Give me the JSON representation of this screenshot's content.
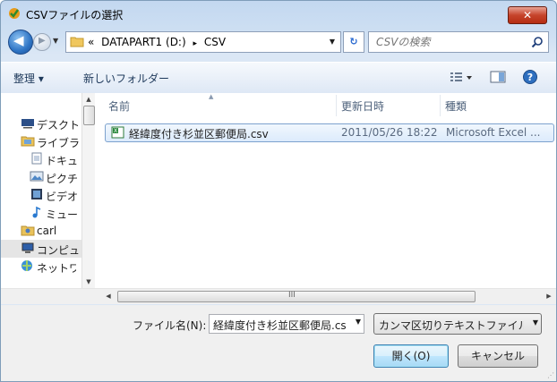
{
  "window": {
    "title": "CSVファイルの選択",
    "close_label": "✕"
  },
  "nav": {
    "address_crumbs": [
      "«",
      "DATAPART1 (D:)",
      "▸",
      "CSV"
    ],
    "search_placeholder": "CSVの検索"
  },
  "toolbar": {
    "organize_label": "整理 ▾",
    "new_folder_label": "新しいフォルダー"
  },
  "sidebar": {
    "items": [
      {
        "label": "デスクトップ",
        "icon": "desktop-icon"
      },
      {
        "label": "ライブラリ",
        "icon": "library-icon"
      },
      {
        "label": "ドキュメント",
        "icon": "document-icon"
      },
      {
        "label": "ピクチャ",
        "icon": "picture-icon"
      },
      {
        "label": "ビデオ",
        "icon": "video-icon"
      },
      {
        "label": "ミュージック",
        "icon": "music-icon"
      },
      {
        "label": "carl",
        "icon": "user-folder-icon"
      },
      {
        "label": "コンピューター",
        "icon": "computer-icon"
      },
      {
        "label": "ネットワーク",
        "icon": "network-icon"
      }
    ]
  },
  "files": {
    "columns": [
      "名前",
      "更新日時",
      "種類"
    ],
    "rows": [
      {
        "name": "経緯度付き杉並区郵便局.csv",
        "modified": "2011/05/26 18:22",
        "type": "Microsoft Excel ..."
      }
    ]
  },
  "hscroll": {
    "grip": "III"
  },
  "bottom": {
    "filename_label": "ファイル名(N):",
    "filename_value": "経緯度付き杉並区郵便局.csv",
    "filetype_value": "カンマ区切りテキストファイル",
    "open_label": "開く(O)",
    "cancel_label": "キャンセル"
  },
  "colors": {
    "accent": "#3c7fb1",
    "selection": "#dcebfc",
    "chrome": "#cfe0f3"
  }
}
